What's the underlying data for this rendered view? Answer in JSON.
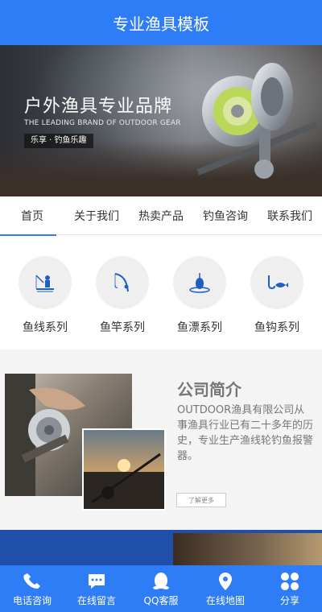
{
  "header": {
    "title": "专业渔具模板"
  },
  "banner": {
    "title": "户外渔具专业品牌",
    "subtitle": "THE LEADING BRAND OF OUTDOOR GEAR",
    "tag": "乐享 · 钓鱼乐趣"
  },
  "nav": {
    "items": [
      {
        "label": "首页",
        "active": true
      },
      {
        "label": "关于我们"
      },
      {
        "label": "热卖产品"
      },
      {
        "label": "钓鱼咨询"
      },
      {
        "label": "联系我们"
      }
    ]
  },
  "categories": [
    {
      "label": "鱼线系列",
      "icon": "fisherman-icon"
    },
    {
      "label": "鱼竿系列",
      "icon": "fishing-rod-icon"
    },
    {
      "label": "鱼漂系列",
      "icon": "float-icon"
    },
    {
      "label": "鱼钩系列",
      "icon": "hook-fish-icon"
    }
  ],
  "about": {
    "heading": "公司简介",
    "description": "OUTDOOR渔具有限公司从事渔具行业已有二十多年的历史，专业生产渔线轮钓鱼报警器。",
    "more_label": "了解更多"
  },
  "bottom_bar": {
    "items": [
      {
        "label": "电话咨询",
        "icon": "phone-icon"
      },
      {
        "label": "在线留言",
        "icon": "chat-icon"
      },
      {
        "label": "QQ客服",
        "icon": "qq-icon"
      },
      {
        "label": "在线地图",
        "icon": "map-pin-icon"
      },
      {
        "label": "分享",
        "icon": "share-icon"
      }
    ]
  },
  "colors": {
    "primary": "#2f7df6",
    "icon_blue": "#1f5fbf"
  }
}
